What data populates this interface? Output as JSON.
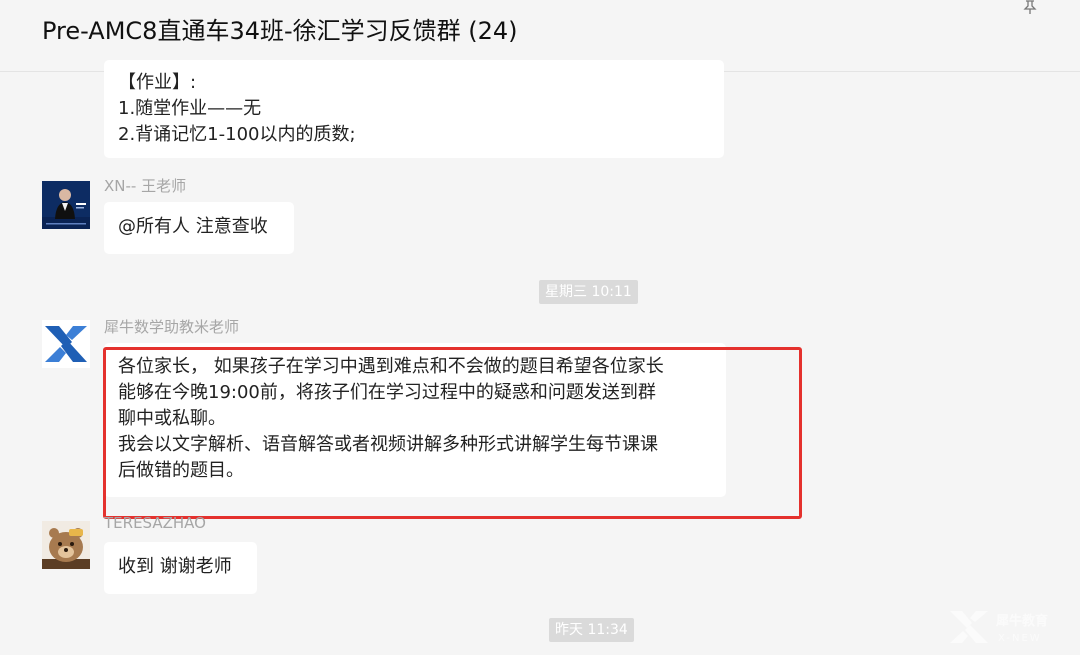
{
  "window": {
    "title": "Pre-AMC8直通车34班-徐汇学习反馈群 (24)"
  },
  "messages": {
    "homework": {
      "lines": [
        "【作业】:",
        "1.随堂作业——无",
        "2.背诵记忆1-100以内的质数;"
      ]
    },
    "msg_wang": {
      "sender": "XN-- 王老师",
      "text": "@所有人 注意查收"
    },
    "time_1": "星期三 10:11",
    "msg_mi": {
      "sender": "犀牛数学助教米老师",
      "lines": [
        "各位家长，  如果孩子在学习中遇到难点和不会做的题目希望各位家长",
        "能够在今晚19:00前，将孩子们在学习过程中的疑惑和问题发送到群",
        "聊中或私聊。",
        "我会以文字解析、语音解答或者视频讲解多种形式讲解学生每节课课",
        "后做错的题目。"
      ]
    },
    "msg_teresa": {
      "sender": "TERESAZHAO",
      "text": "收到 谢谢老师"
    },
    "time_2": "昨天 11:34"
  },
  "watermark": {
    "brand_cn": "犀牛教育",
    "brand_en": "X - N E W"
  },
  "colors": {
    "highlight": "#e4312d",
    "background": "#f5f5f5",
    "bubble": "#ffffff"
  }
}
